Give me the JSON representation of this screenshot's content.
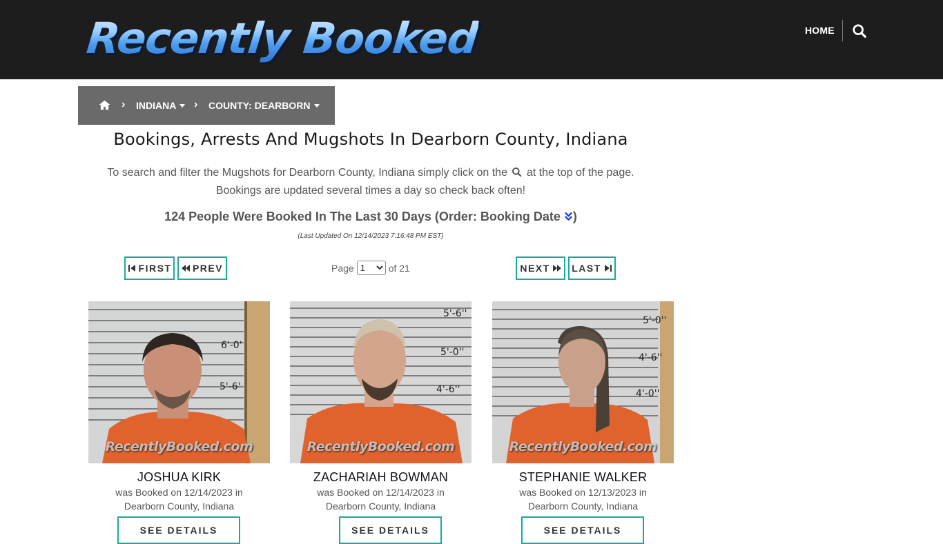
{
  "header": {
    "logo_text": "Recently Booked",
    "nav_home": "HOME",
    "search_icon": "search-icon"
  },
  "breadcrumb": {
    "home_icon": "home-icon",
    "state": "INDIANA",
    "county": "COUNTY: DEARBORN"
  },
  "main": {
    "title": "Bookings, Arrests And Mugshots In Dearborn County, Indiana",
    "intro_part1": "To search and filter the Mugshots for Dearborn County, Indiana simply click on the",
    "intro_part2": "at the top of the page.",
    "intro_line2": "Bookings are updated several times a day so check back often!",
    "count_text": "124 People Were Booked In The Last 30 Days (Order: Booking Date",
    "count_close": ")",
    "last_updated": "(Last Updated On 12/14/2023 7:16:48 PM EST)"
  },
  "pagination": {
    "first": "FIRST",
    "prev": "PREV",
    "next": "NEXT",
    "last": "LAST",
    "page_label": "Page",
    "current_page": "1",
    "of_label": "of 21"
  },
  "bookings": [
    {
      "name": "JOSHUA KIRK",
      "booked_line": "was Booked on 12/14/2023 in",
      "location": "Dearborn County, Indiana",
      "watermark": "RecentlyBooked.com",
      "details_label": "SEE DETAILS",
      "height_marks": [
        "6'-0'",
        "5'-6'"
      ]
    },
    {
      "name": "ZACHARIAH BOWMAN",
      "booked_line": "was Booked on 12/14/2023 in",
      "location": "Dearborn County, Indiana",
      "watermark": "RecentlyBooked.com",
      "details_label": "SEE DETAILS",
      "height_marks": [
        "5'-6''",
        "5'-0''",
        "4'-6''"
      ]
    },
    {
      "name": "STEPHANIE WALKER",
      "booked_line": "was Booked on 12/13/2023 in",
      "location": "Dearborn County, Indiana",
      "watermark": "RecentlyBooked.com",
      "details_label": "SEE DETAILS",
      "height_marks": [
        "5'-0''",
        "4'-6''",
        "4'-0''"
      ]
    }
  ],
  "colors": {
    "header_bg": "#1d1d1d",
    "breadcrumb_bg": "#6a6a6a",
    "accent_teal": "#1aaa9c",
    "jumpsuit_orange": "#e0622c"
  }
}
